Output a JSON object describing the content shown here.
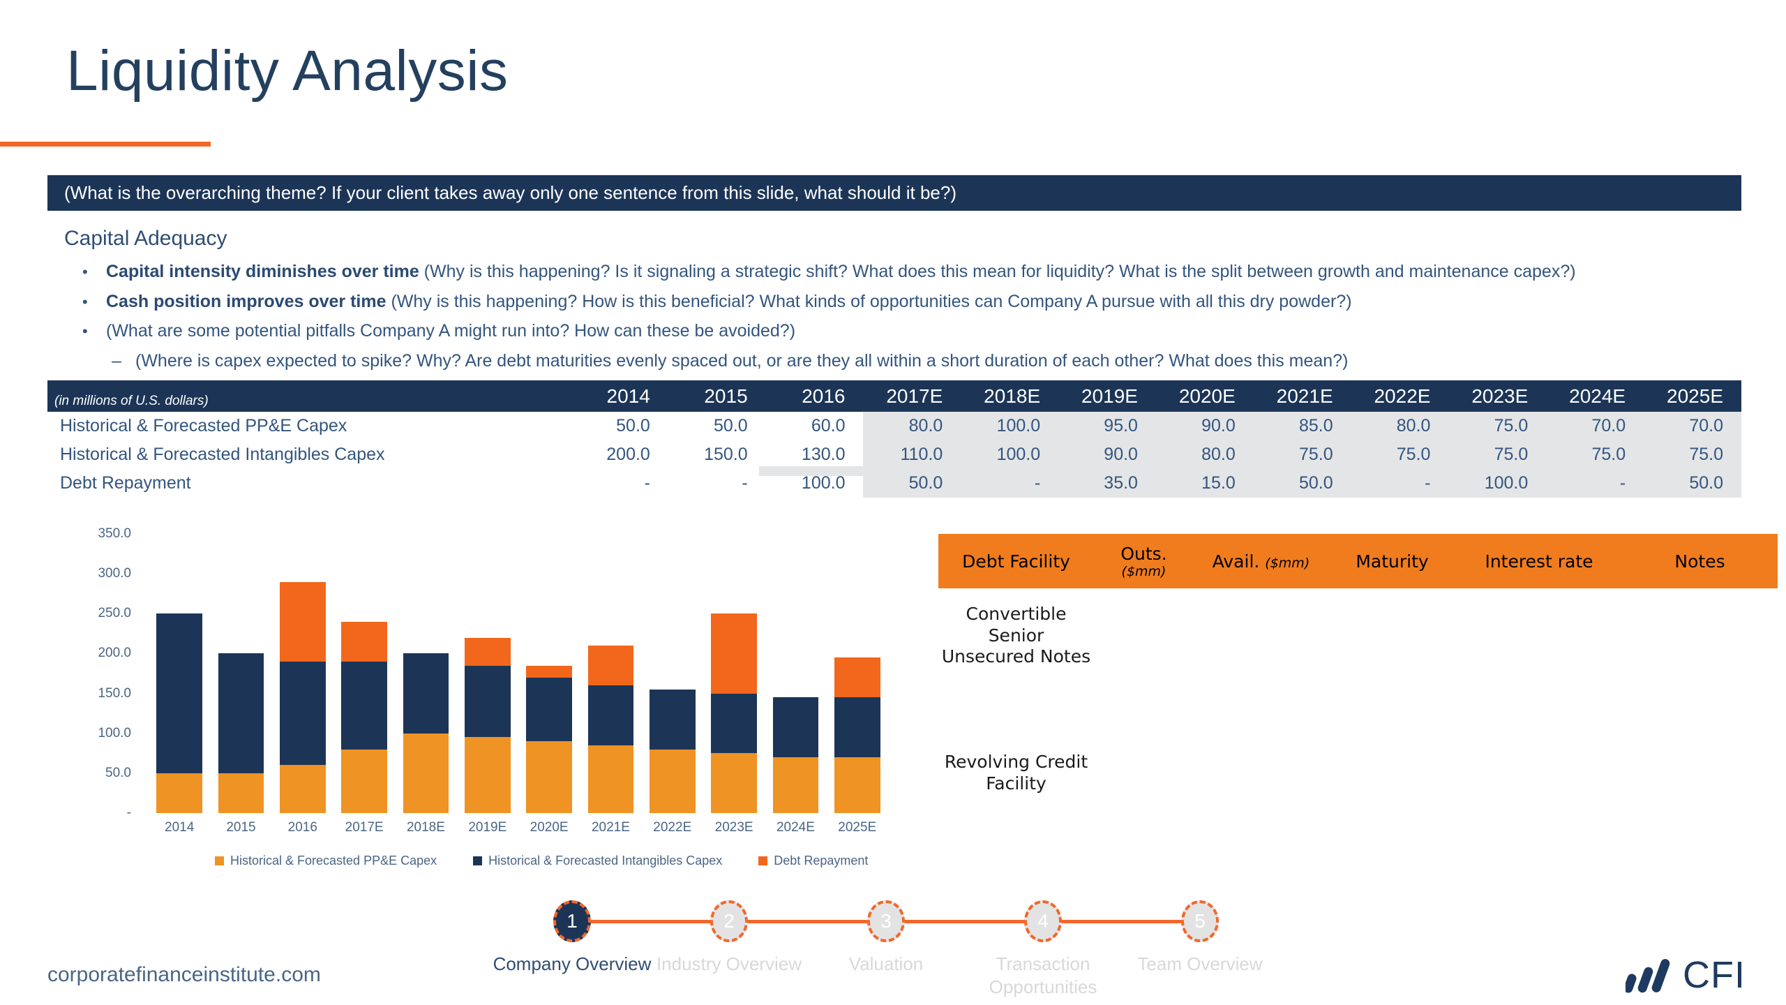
{
  "slide": {
    "title": "Liquidity Analysis",
    "theme_banner": "(What is the overarching theme? If your client takes away only one sentence from this slide, what should it be?)",
    "section_heading": "Capital Adequacy"
  },
  "bullets": [
    {
      "marker": "•",
      "strong": "Capital intensity diminishes over time",
      "rest": " (Why is this happening? Is it signaling a strategic shift? What does this mean for liquidity? What is the split between growth and maintenance capex?)"
    },
    {
      "marker": "•",
      "strong": "Cash position improves over time",
      "rest": " (Why is this happening? How is this beneficial? What kinds of opportunities can Company A pursue with all this dry powder?)"
    },
    {
      "marker": "•",
      "strong": "",
      "rest": "(What are some potential pitfalls Company A might run into? How can these be avoided?)"
    },
    {
      "marker": "–",
      "strong": "",
      "rest": "(Where is capex expected to spike? Why? Are debt maturities evenly spaced out, or are they all within a short duration of each other? What does this mean?)"
    }
  ],
  "capex_table": {
    "unit_label": "(in millions of U.S. dollars)",
    "columns": [
      "2014",
      "2015",
      "2016",
      "2017E",
      "2018E",
      "2019E",
      "2020E",
      "2021E",
      "2022E",
      "2023E",
      "2024E",
      "2025E"
    ],
    "estimate_start_index": 3,
    "rows": [
      {
        "label": "Historical & Forecasted PP&E Capex",
        "values": [
          "50.0",
          "50.0",
          "60.0",
          "80.0",
          "100.0",
          "95.0",
          "90.0",
          "85.0",
          "80.0",
          "75.0",
          "70.0",
          "70.0"
        ]
      },
      {
        "label": "Historical & Forecasted Intangibles Capex",
        "values": [
          "200.0",
          "150.0",
          "130.0",
          "110.0",
          "100.0",
          "90.0",
          "80.0",
          "75.0",
          "75.0",
          "75.0",
          "75.0",
          "75.0"
        ]
      },
      {
        "label": "Debt Repayment",
        "values": [
          "-",
          "-",
          "100.0",
          "50.0",
          "-",
          "35.0",
          "15.0",
          "50.0",
          "-",
          "100.0",
          "-",
          "50.0"
        ]
      }
    ]
  },
  "chart_data": {
    "type": "bar",
    "stacked": true,
    "title": "",
    "xlabel": "",
    "ylabel": "",
    "ylim": [
      0,
      350
    ],
    "grid": false,
    "legend_position": "bottom",
    "ytick_labels": [
      "-",
      "50.0",
      "100.0",
      "150.0",
      "200.0",
      "250.0",
      "300.0",
      "350.0"
    ],
    "ytick_values": [
      0,
      50,
      100,
      150,
      200,
      250,
      300,
      350
    ],
    "categories": [
      "2014",
      "2015",
      "2016",
      "2017E",
      "2018E",
      "2019E",
      "2020E",
      "2021E",
      "2022E",
      "2023E",
      "2024E",
      "2025E"
    ],
    "series": [
      {
        "name": "Historical & Forecasted PP&E Capex",
        "color": "#EF9324",
        "values": [
          50,
          50,
          60,
          80,
          100,
          95,
          90,
          85,
          80,
          75,
          70,
          70
        ]
      },
      {
        "name": "Historical & Forecasted Intangibles Capex",
        "color": "#1C3557",
        "values": [
          200,
          150,
          130,
          110,
          100,
          90,
          80,
          75,
          75,
          75,
          75,
          75
        ]
      },
      {
        "name": "Debt Repayment",
        "color": "#F2671B",
        "values": [
          0,
          0,
          100,
          50,
          0,
          35,
          15,
          50,
          0,
          100,
          0,
          50
        ]
      }
    ],
    "totals": [
      250,
      200,
      290,
      240,
      200,
      220,
      185,
      210,
      155,
      250,
      145,
      195
    ]
  },
  "debt_table": {
    "columns": [
      {
        "label": "Debt Facility",
        "sub": "",
        "stack": false
      },
      {
        "label": "Outs.",
        "sub": "($mm)",
        "stack": true
      },
      {
        "label": "Avail.",
        "sub": "($mm)",
        "stack": false
      },
      {
        "label": "Maturity",
        "sub": "",
        "stack": false
      },
      {
        "label": "Interest rate",
        "sub": "",
        "stack": false
      },
      {
        "label": "Notes",
        "sub": "",
        "stack": false
      }
    ],
    "rows": [
      {
        "facility": "Convertible Senior Unsecured Notes",
        "outstanding": "",
        "available": "",
        "maturity": "",
        "interest_rate": "",
        "notes": ""
      },
      {
        "facility": "Revolving Credit Facility",
        "outstanding": "",
        "available": "",
        "maturity": "",
        "interest_rate": "",
        "notes": ""
      }
    ]
  },
  "stepper": {
    "steps": [
      {
        "number": "1",
        "label": "Company Overview",
        "active": true
      },
      {
        "number": "2",
        "label": "Industry Overview",
        "active": false
      },
      {
        "number": "3",
        "label": "Valuation",
        "active": false
      },
      {
        "number": "4",
        "label": "Transaction Opportunities",
        "active": false
      },
      {
        "number": "5",
        "label": "Team Overview",
        "active": false
      }
    ]
  },
  "footer": {
    "url": "corporatefinanceinstitute.com",
    "logo_text": "CFI"
  },
  "colors": {
    "navy": "#1C3557",
    "orange": "#F2672A",
    "ppe_orange": "#EF9324",
    "debt_orange": "#F2671B",
    "header_orange": "#F07C1E",
    "shade_grey": "#E4E5E7"
  }
}
